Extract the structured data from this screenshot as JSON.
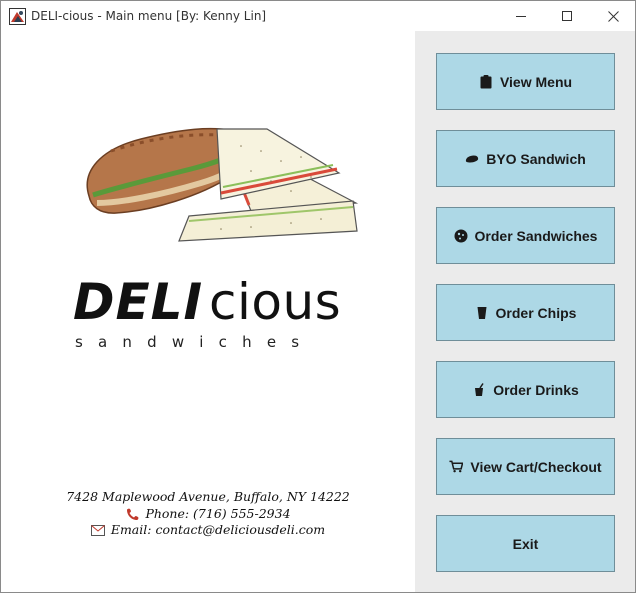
{
  "window": {
    "title": "DELI-cious - Main menu [By: Kenny Lin]"
  },
  "brand": {
    "logo_bold": "DELI",
    "logo_light": "cious",
    "tagline": "sandwiches"
  },
  "contact": {
    "address": "7428 Maplewood Avenue, Buffalo, NY 14222",
    "phone": "Phone: (716) 555-2934",
    "email": "Email: contact@deliciousdeli.com"
  },
  "menu": {
    "buttons": [
      {
        "label": "View Menu",
        "icon": "clipboard-icon"
      },
      {
        "label": "BYO Sandwich",
        "icon": "bread-icon"
      },
      {
        "label": "Order Sandwiches",
        "icon": "cookie-icon"
      },
      {
        "label": "Order Chips",
        "icon": "cup-icon"
      },
      {
        "label": "Order Drinks",
        "icon": "drink-icon"
      },
      {
        "label": "View Cart/Checkout",
        "icon": "cart-icon"
      },
      {
        "label": "Exit",
        "icon": ""
      }
    ]
  },
  "colors": {
    "button_bg": "#add8e6",
    "panel_bg": "#ebebeb"
  }
}
